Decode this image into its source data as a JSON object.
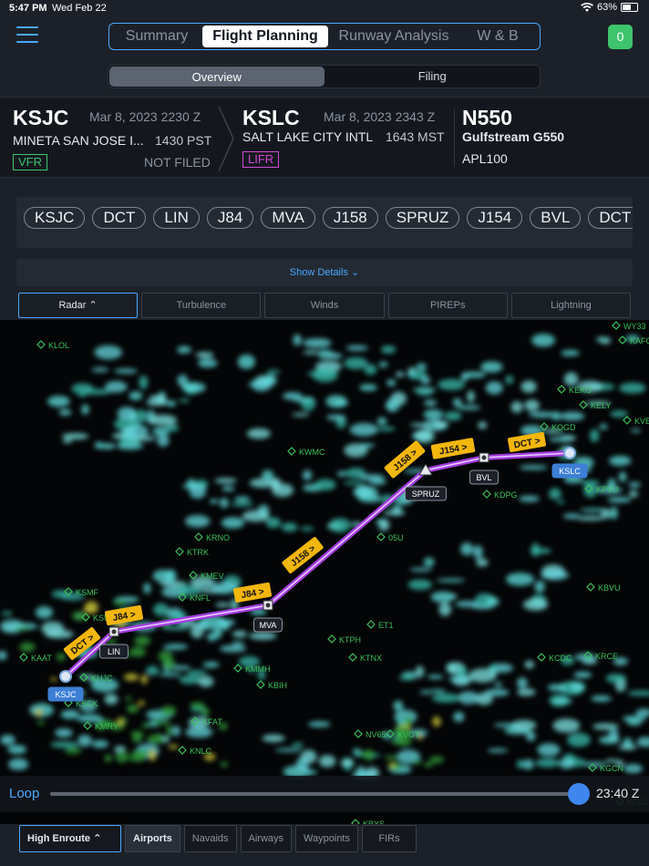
{
  "status": {
    "time": "5:47 PM",
    "date": "Wed Feb 22",
    "battery": "63%"
  },
  "nav": {
    "tabs": [
      "Summary",
      "Flight Planning",
      "Runway Analysis",
      "W & B"
    ],
    "active_tab": "Flight Planning",
    "badge": "0",
    "subtabs": [
      "Overview",
      "Filing"
    ]
  },
  "departure": {
    "code": "KSJC",
    "datetime": "Mar 8, 2023 2230 Z",
    "name": "MINETA SAN JOSE I...",
    "local": "1430 PST",
    "rules": "VFR",
    "status": "NOT FILED"
  },
  "arrival": {
    "code": "KSLC",
    "datetime": "Mar 8, 2023 2343 Z",
    "name": "SALT LAKE CITY INTL",
    "local": "1643 MST",
    "rules": "LIFR"
  },
  "aircraft": {
    "tail": "N550",
    "type": "Gulfstream G550",
    "id": "APL100"
  },
  "route": [
    "KSJC",
    "DCT",
    "LIN",
    "J84",
    "MVA",
    "J158",
    "SPRUZ",
    "J154",
    "BVL",
    "DCT",
    "KSLC"
  ],
  "show_details": "Show Details",
  "layers": [
    "Radar",
    "Turbulence",
    "Winds",
    "PIREPs",
    "Lightning"
  ],
  "map": {
    "waypoints": [
      {
        "label": "KSJC",
        "kind": "airport"
      },
      {
        "label": "LIN",
        "kind": "vor"
      },
      {
        "label": "MVA",
        "kind": "vor"
      },
      {
        "label": "SPRUZ",
        "kind": "fix"
      },
      {
        "label": "BVL",
        "kind": "vor"
      },
      {
        "label": "KSLC",
        "kind": "airport"
      }
    ],
    "airways": [
      "DCT >",
      "J84 >",
      "J84 >",
      "J158 >",
      "J158 >",
      "J154 >",
      "DCT >"
    ],
    "airports": [
      "KAFO",
      "WY33",
      "KVEW",
      "KSUU",
      "KMMH",
      "KBIH",
      "KTPH",
      "KTNX",
      "KRNO",
      "KTRK",
      "KMEV",
      "KSMF",
      "KLOL",
      "KELY",
      "KDPG",
      "KPVU",
      "KOGD",
      "KCDC",
      "KRCE",
      "KBVU",
      "KGCN",
      "KFLG",
      "KBYS",
      "ET1",
      "05U",
      "NV65",
      "KVGT",
      "KEKO",
      "KWMC",
      "KNFL",
      "KHJC",
      "KMRY",
      "KFAT",
      "KNLC",
      "KSCK",
      "KAAT"
    ]
  },
  "loop": {
    "label": "Loop",
    "time": "23:40 Z"
  },
  "bottom": {
    "chart": "High Enroute",
    "toggles": [
      "Airports",
      "Navaids",
      "Airways",
      "Waypoints",
      "FIRs"
    ]
  }
}
